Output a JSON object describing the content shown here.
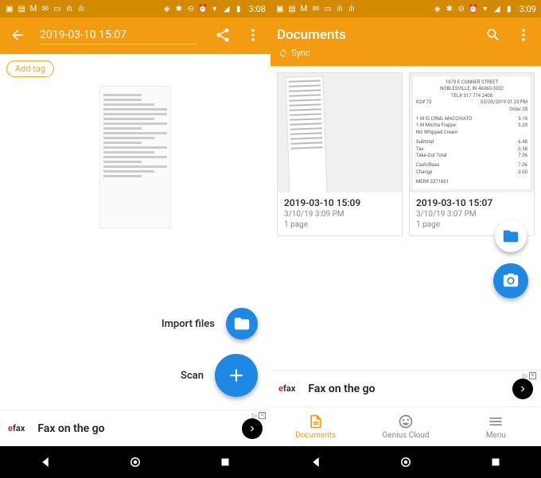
{
  "left": {
    "statusbar_time": "3:08",
    "doc_title_value": "2019-03-10 15:07",
    "add_tag_label": "Add tag",
    "fab_import_label": "Import files",
    "fab_scan_label": "Scan",
    "ad": {
      "logo_prefix": "e",
      "logo_brand": "fax",
      "text": "Fax on the go"
    }
  },
  "right": {
    "statusbar_time": "3:09",
    "appbar_title": "Documents",
    "sync_label": "Sync",
    "cards": [
      {
        "title": "2019-03-10 15:09",
        "sub": "3/10/19 3:09 PM",
        "pages": "1 page"
      },
      {
        "title": "2019-03-10 15:07",
        "sub": "3/10/19 3:07 PM",
        "pages": "1 page"
      }
    ],
    "receipt_detail": {
      "addr1": "1970 E CONNER STREET",
      "addr2": "NOBLESVILLE, IN 46060-3032",
      "tel": "TEL# 317 774 2408",
      "ksn": "KS# 73",
      "date": "03/05/2019 01:23 PM",
      "order": "Order 28",
      "items": [
        {
          "name": "1 M IC CRML MACCHIATO",
          "price": "3.19"
        },
        {
          "name": "1 M Mocha Frappe",
          "price": "3.29"
        },
        {
          "name": "NO Whipped Cream",
          "price": ""
        }
      ],
      "subtotal_label": "Subtotal",
      "subtotal": "6.48",
      "tax_label": "Tax",
      "tax": "0.58",
      "total_label": "Take-Out Total",
      "total": "7.06",
      "cash_label": "Cash/Base",
      "cash": "7.06",
      "change_label": "Change",
      "change": "0.00",
      "mfy": "MER# 2371601"
    },
    "ad": {
      "logo_prefix": "e",
      "logo_brand": "fax",
      "text": "Fax on the go"
    },
    "tabs": [
      {
        "label": "Documents"
      },
      {
        "label": "Genius Cloud"
      },
      {
        "label": "Menu"
      }
    ]
  }
}
